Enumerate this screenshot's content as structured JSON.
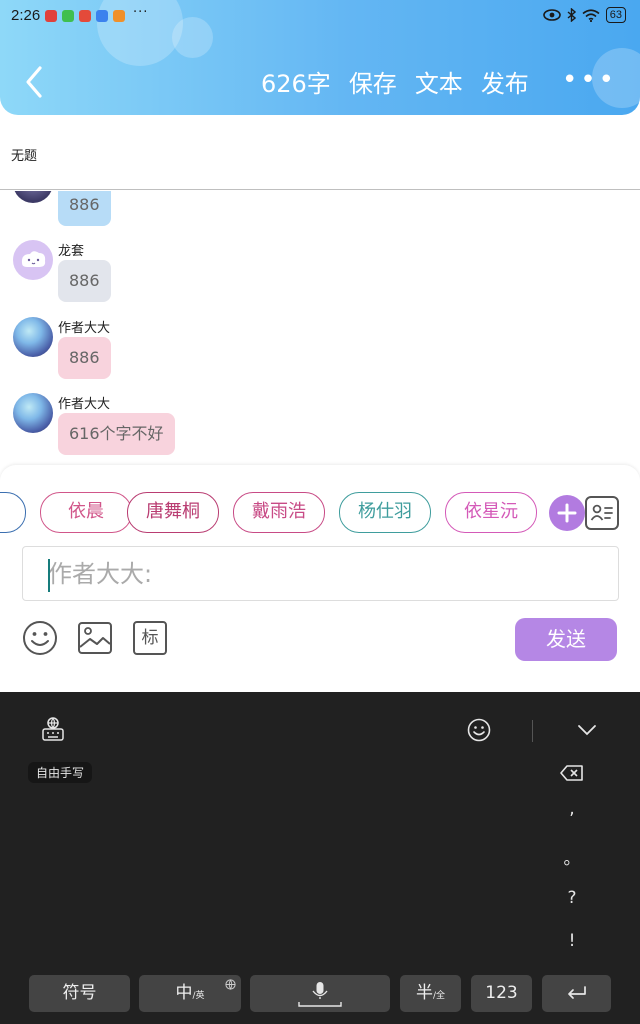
{
  "status_bar": {
    "time": "2:26",
    "more": "···",
    "battery": "63"
  },
  "toolbar": {
    "word_count": "626字",
    "save_label": "保存",
    "text_label": "文本",
    "publish_label": "发布"
  },
  "document": {
    "title": "无题"
  },
  "messages": [
    {
      "name": "",
      "text": "886",
      "bubble_color": "#b7dcf7"
    },
    {
      "name": "龙套",
      "text": "886",
      "bubble_color": "#e2e5ec"
    },
    {
      "name": "作者大大",
      "text": "886",
      "bubble_color": "#f8d3dd"
    },
    {
      "name": "作者大大",
      "text": "616个字不好",
      "bubble_color": "#f8d3dd"
    }
  ],
  "characters": [
    {
      "name": "依晨",
      "color": "#d1568a"
    },
    {
      "name": "唐舞桐",
      "color": "#b93d72"
    },
    {
      "name": "戴雨浩",
      "color": "#c84b86"
    },
    {
      "name": "杨仕羽",
      "color": "#3f9d9d"
    },
    {
      "name": "依星沅",
      "color": "#d45ab8"
    }
  ],
  "composer": {
    "placeholder": "作者大大:",
    "send_label": "发送",
    "tag_icon_label": "标"
  },
  "keyboard": {
    "handwriting_label": "自由手写",
    "punctuation": [
      ",",
      "。",
      "?",
      "!"
    ],
    "keys": {
      "symbols": "符号",
      "lang_main": "中",
      "lang_sub": "/英",
      "half_main": "半",
      "half_sub": "/全",
      "numbers": "123"
    }
  },
  "colors": {
    "header_start": "#8ed8f8",
    "header_end": "#4aa8f0",
    "accent": "#b587e5"
  }
}
